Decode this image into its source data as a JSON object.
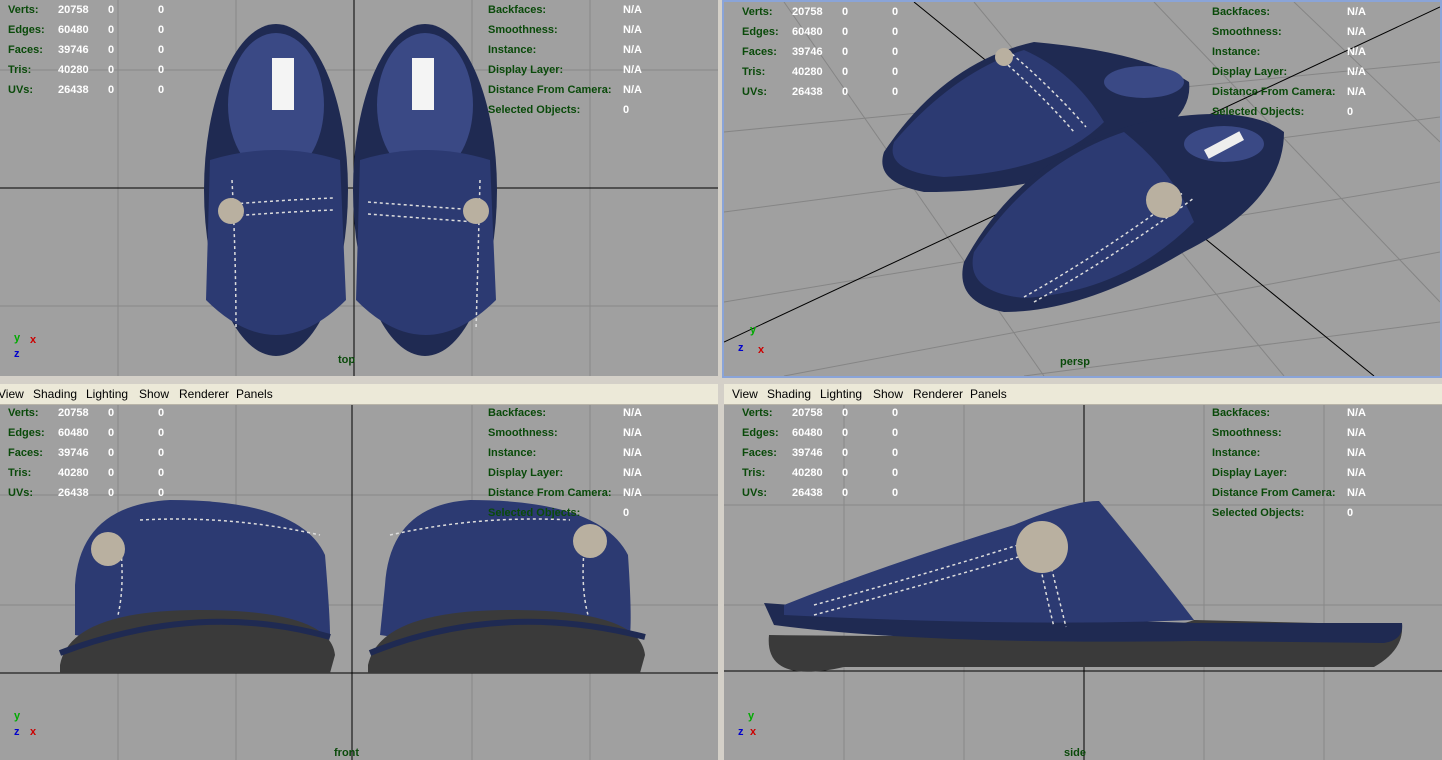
{
  "menu": {
    "view": "View",
    "shading": "Shading",
    "lighting": "Lighting",
    "show": "Show",
    "renderer": "Renderer",
    "panels": "Panels"
  },
  "hud_left": [
    {
      "label": "Verts:",
      "v1": "20758",
      "v2": "0",
      "v3": "0"
    },
    {
      "label": "Edges:",
      "v1": "60480",
      "v2": "0",
      "v3": "0"
    },
    {
      "label": "Faces:",
      "v1": "39746",
      "v2": "0",
      "v3": "0"
    },
    {
      "label": "Tris:",
      "v1": "40280",
      "v2": "0",
      "v3": "0"
    },
    {
      "label": "UVs:",
      "v1": "26438",
      "v2": "0",
      "v3": "0"
    }
  ],
  "hud_right": [
    {
      "label": "Backfaces:",
      "value": "N/A"
    },
    {
      "label": "Smoothness:",
      "value": "N/A"
    },
    {
      "label": "Instance:",
      "value": "N/A"
    },
    {
      "label": "Display Layer:",
      "value": "N/A"
    },
    {
      "label": "Distance From Camera:",
      "value": "N/A"
    },
    {
      "label": "Selected Objects:",
      "value": "0"
    }
  ],
  "viewports": {
    "top": "top",
    "persp": "persp",
    "front": "front",
    "side": "side"
  },
  "axes": {
    "x": "x",
    "y": "y",
    "z": "z"
  },
  "colors": {
    "viewport_bg": "#a0a0a0",
    "grid": "#7f7f7f",
    "axis_line": "#000000",
    "hud_label": "#0a4a0a",
    "slipper": "#2b3a6e",
    "sole": "#3a3a3a",
    "badge": "#b9b0a0",
    "active_border": "#8aa4d8"
  }
}
